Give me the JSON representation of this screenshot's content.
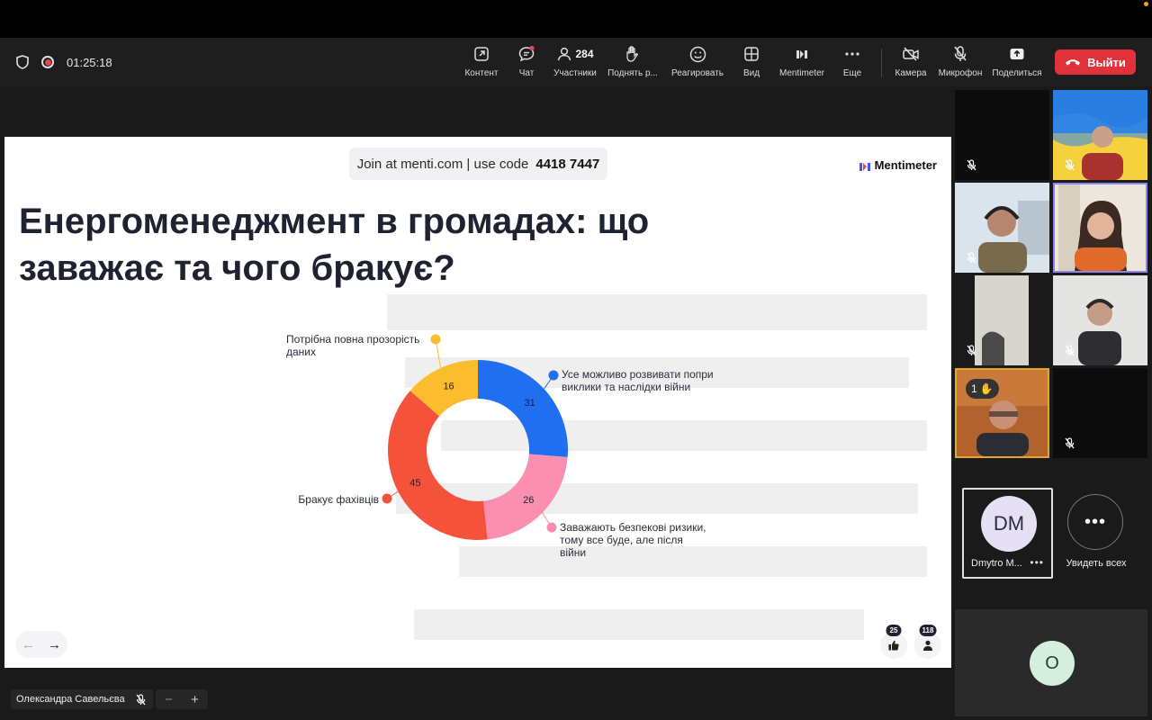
{
  "meeting": {
    "elapsed": "01:25:18"
  },
  "toolbar": {
    "items": [
      {
        "label": "Контент",
        "icon": "share-content-icon"
      },
      {
        "label": "Чат",
        "icon": "chat-icon"
      },
      {
        "label": "Участники",
        "icon": "participants-icon",
        "count": "284"
      },
      {
        "label": "Поднять р...",
        "icon": "raise-hand-icon"
      },
      {
        "label": "Реагировать",
        "icon": "smile-icon"
      },
      {
        "label": "Вид",
        "icon": "grid-view-icon"
      },
      {
        "label": "Mentimeter",
        "icon": "mentimeter-icon"
      },
      {
        "label": "Еще",
        "icon": "more-icon"
      },
      {
        "label": "Камера",
        "icon": "camera-off-icon"
      },
      {
        "label": "Микрофон",
        "icon": "mic-off-icon"
      },
      {
        "label": "Поделиться",
        "icon": "share-icon"
      }
    ],
    "leave_label": "Выйти"
  },
  "slide": {
    "join_text": "Join at menti.com | use code",
    "code": "4418 7447",
    "brand": "Mentimeter",
    "title": "Енергоменеджмент в громадах: що заважає та чого бракує?",
    "reactions": {
      "likes": "25",
      "participants": "118"
    }
  },
  "chart_data": {
    "type": "pie",
    "donut": true,
    "slices": [
      {
        "label": "Усе можливо розвивати попри виклики та наслідки війни",
        "value": 31,
        "color": "#1f6ff0"
      },
      {
        "label": "Заважають безпекові ризики, тому все буде, але після війни",
        "value": 26,
        "color": "#fb8fb0"
      },
      {
        "label": "Бракує фахівців",
        "value": 45,
        "color": "#f4523b"
      },
      {
        "label": "Потрібна повна прозорість даних",
        "value": 16,
        "color": "#fbbd2e"
      }
    ],
    "legend_placement": "around"
  },
  "participants": {
    "dm_initials": "DM",
    "dm_name": "Dmytro M...",
    "see_all": "Увидеть всех",
    "hand_count": "1",
    "o_initial": "O",
    "self_name": "Олександра Савельєва"
  }
}
